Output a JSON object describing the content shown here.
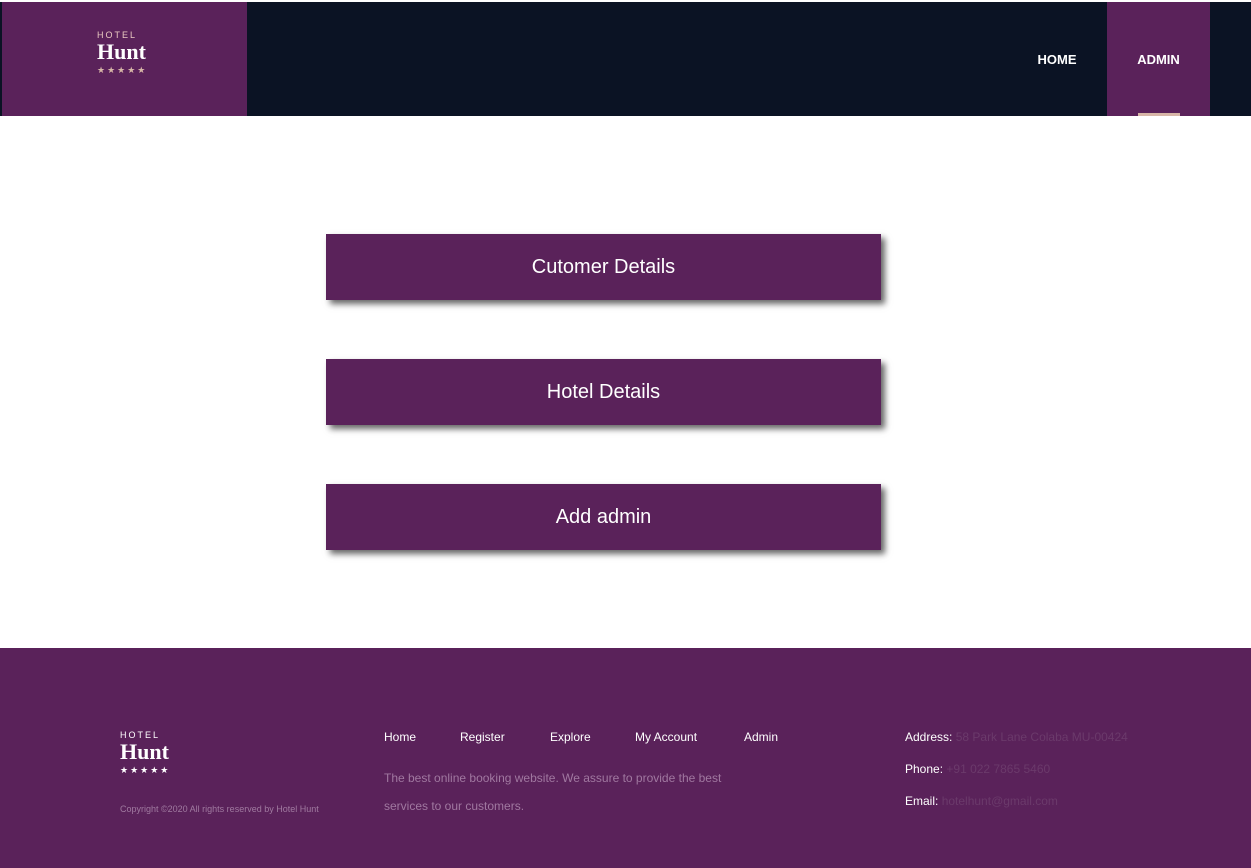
{
  "brand": {
    "small": "HOTEL",
    "name": "Hunt",
    "stars": "★★★★★"
  },
  "nav": {
    "home": "HOME",
    "admin": "ADMIN"
  },
  "actions": {
    "customer_details": "Cutomer Details",
    "hotel_details": "Hotel Details",
    "add_admin": "Add admin"
  },
  "footer": {
    "copyright": "Copyright ©2020 All rights reserved by Hotel Hunt",
    "links": {
      "home": "Home",
      "register": "Register",
      "explore": "Explore",
      "my_account": "My Account",
      "admin": "Admin"
    },
    "description": "The best online booking website. We assure to provide the best services to our customers.",
    "contact": {
      "address_label": "Address:",
      "address_value": "58 Park Lane Colaba MU-00424",
      "phone_label": "Phone:",
      "phone_value": "+91 022 7865 5460",
      "email_label": "Email:",
      "email_value": "hotelhunt@gmail.com"
    }
  },
  "colors": {
    "brand_purple": "#5a225a",
    "header_navy": "#0b1324",
    "accent_rose": "#d7b6a7"
  }
}
